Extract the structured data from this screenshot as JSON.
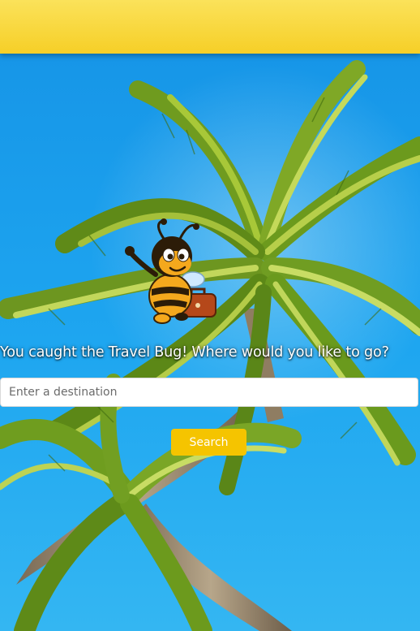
{
  "header": {
    "bar_color": "#f9d835"
  },
  "hero": {
    "background_image": "palm-tree-blue-sky",
    "mascot_icon": "travel-bug-bee-with-suitcase-icon"
  },
  "main": {
    "headline": "You caught the Travel Bug! Where would you like to go?",
    "search": {
      "placeholder": "Enter a destination",
      "value": "",
      "button_label": "Search",
      "button_color": "#f5c400"
    }
  }
}
